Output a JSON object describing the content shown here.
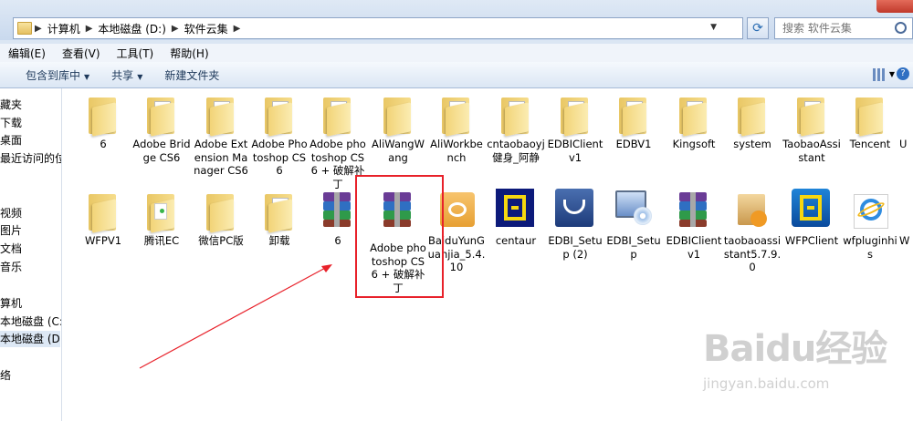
{
  "address": {
    "crumbs": [
      "计算机",
      "本地磁盘 (D:)",
      "软件云集"
    ],
    "search_placeholder": "搜索 软件云集"
  },
  "menu": [
    "编辑(E)",
    "查看(V)",
    "工具(T)",
    "帮助(H)"
  ],
  "toolbar": {
    "include_library": "包含到库中",
    "share": "共享",
    "new_folder": "新建文件夹"
  },
  "sidebar": [
    "藏夹",
    "下载",
    "桌面",
    "最近访问的位置",
    "视频",
    "图片",
    "文档",
    "音乐",
    "算机",
    "本地磁盘 (C:)",
    "本地磁盘 (D:)",
    "络"
  ],
  "files_row1": [
    {
      "label": "6",
      "type": "folder"
    },
    {
      "label": "Adobe Bridge CS6",
      "type": "folder"
    },
    {
      "label": "Adobe Extension Manager CS6",
      "type": "folder"
    },
    {
      "label": "Adobe Photoshop CS6",
      "type": "folder"
    },
    {
      "label": "Adobe photoshop CS6 + 破解补丁",
      "type": "folder"
    },
    {
      "label": "AliWangWang",
      "type": "folder"
    },
    {
      "label": "AliWorkbench",
      "type": "folder"
    },
    {
      "label": "cntaobaoyj健身_阿静",
      "type": "folder"
    },
    {
      "label": "EDBIClientv1",
      "type": "folder"
    },
    {
      "label": "EDBV1",
      "type": "folder"
    },
    {
      "label": "Kingsoft",
      "type": "folder"
    },
    {
      "label": "system",
      "type": "folder"
    },
    {
      "label": "TaobaoAssistant",
      "type": "folder"
    },
    {
      "label": "Tencent",
      "type": "folder"
    },
    {
      "label": "U",
      "type": "folder"
    }
  ],
  "files_row2": [
    {
      "label": "WFPV1",
      "type": "folder"
    },
    {
      "label": "腾讯EC",
      "type": "folder"
    },
    {
      "label": "微信PC版",
      "type": "folder"
    },
    {
      "label": "卸载",
      "type": "folder"
    },
    {
      "label": "6",
      "type": "rar"
    },
    {
      "label": "Adobe photoshop CS6 + 破解补丁",
      "type": "rar"
    },
    {
      "label": "BaiduYunGuanjia_5.4.10",
      "type": "baidu"
    },
    {
      "label": "centaur",
      "type": "centaur"
    },
    {
      "label": "EDBI_Setup (2)",
      "type": "setup2"
    },
    {
      "label": "EDBI_Setup",
      "type": "setup"
    },
    {
      "label": "EDBIClientv1",
      "type": "rar"
    },
    {
      "label": "taobaoassistant5.7.9.0",
      "type": "taobao"
    },
    {
      "label": "WFPClient",
      "type": "wfp"
    },
    {
      "label": "wfpluginhis",
      "type": "ie"
    },
    {
      "label": "W",
      "type": "folder"
    }
  ],
  "watermark": {
    "brand": "Baidu经验",
    "url": "jingyan.baidu.com"
  }
}
